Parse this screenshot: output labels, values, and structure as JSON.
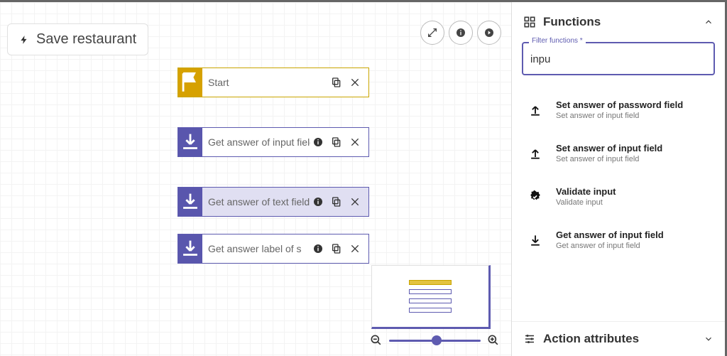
{
  "chip": {
    "label": "Save restaurant"
  },
  "nodes": {
    "start": {
      "label": "Start"
    },
    "n1": {
      "label": "Get answer of input field"
    },
    "n2": {
      "label": "Get answer of text field"
    },
    "n3": {
      "label": "Get answer label of s"
    }
  },
  "panel": {
    "functions_title": "Functions",
    "filter_legend": "Filter functions *",
    "filter_value": "inpu",
    "items": [
      {
        "title": "Set answer of password field",
        "sub": "Set answer of input field"
      },
      {
        "title": "Set answer of input field",
        "sub": "Set answer of input field"
      },
      {
        "title": "Validate input",
        "sub": "Validate input"
      },
      {
        "title": "Get answer of input field",
        "sub": "Get answer of input field"
      }
    ],
    "attr_title": "Action attributes"
  }
}
